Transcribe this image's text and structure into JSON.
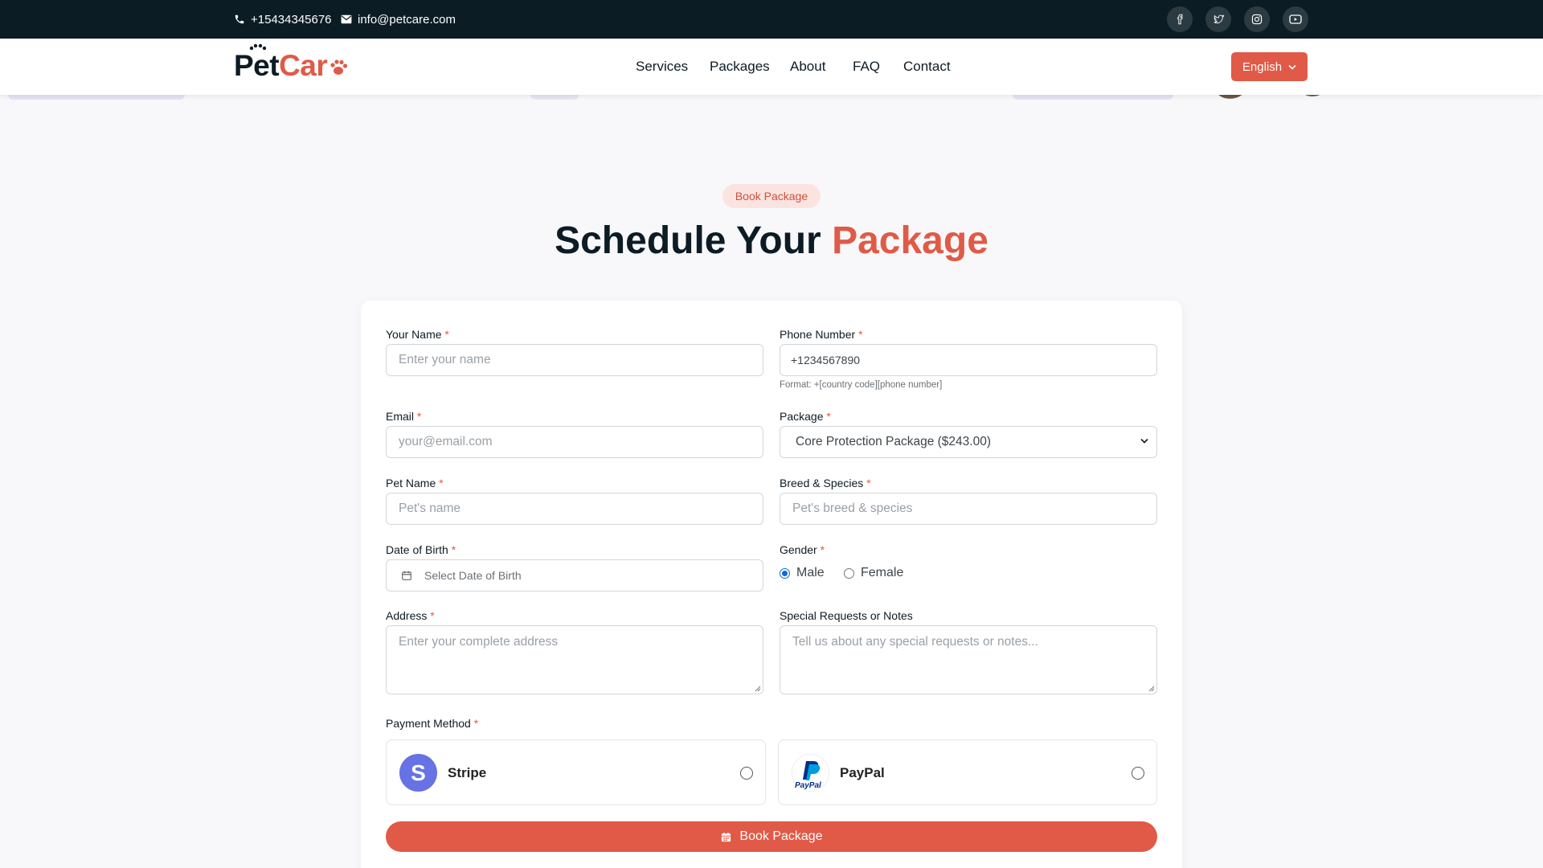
{
  "topbar": {
    "phone": "+15434345676",
    "email": "info@petcare.com",
    "social_icons": [
      "facebook-icon",
      "twitter-icon",
      "instagram-icon",
      "youtube-icon"
    ]
  },
  "navbar": {
    "logo_part1": "Pet",
    "logo_part2": "Car",
    "links": [
      "Services",
      "Packages",
      "About",
      "FAQ",
      "Contact"
    ],
    "language": "English"
  },
  "hero": {
    "badge": "Book Package",
    "title_main": "Schedule Your",
    "title_accent": "Package"
  },
  "form": {
    "name": {
      "label": "Your Name",
      "placeholder": "Enter your name"
    },
    "phone": {
      "label": "Phone Number",
      "value": "+1234567890",
      "hint": "Format: +[country code][phone number]"
    },
    "email": {
      "label": "Email",
      "placeholder": "your@email.com"
    },
    "package": {
      "label": "Package",
      "selected": "Core Protection Package ($243.00)"
    },
    "pet_name": {
      "label": "Pet Name",
      "placeholder": "Pet's name"
    },
    "breed": {
      "label": "Breed & Species",
      "placeholder": "Pet's breed & species"
    },
    "dob": {
      "label": "Date of Birth",
      "placeholder": "Select Date of Birth"
    },
    "gender": {
      "label": "Gender",
      "options": [
        "Male",
        "Female"
      ],
      "selected": "Male"
    },
    "address": {
      "label": "Address",
      "placeholder": "Enter your complete address"
    },
    "notes": {
      "label": "Special Requests or Notes",
      "placeholder": "Tell us about any special requests or notes..."
    },
    "payment": {
      "label": "Payment Method",
      "methods": [
        "Stripe",
        "PayPal"
      ],
      "stripe_letter": "S",
      "paypal_small": "PayPal"
    },
    "required_mark": "*",
    "submit": "Book Package"
  },
  "colors": {
    "accent": "#e05a47",
    "dark": "#0b1c24",
    "stripe": "#6772e5",
    "paypal": "#003087"
  }
}
